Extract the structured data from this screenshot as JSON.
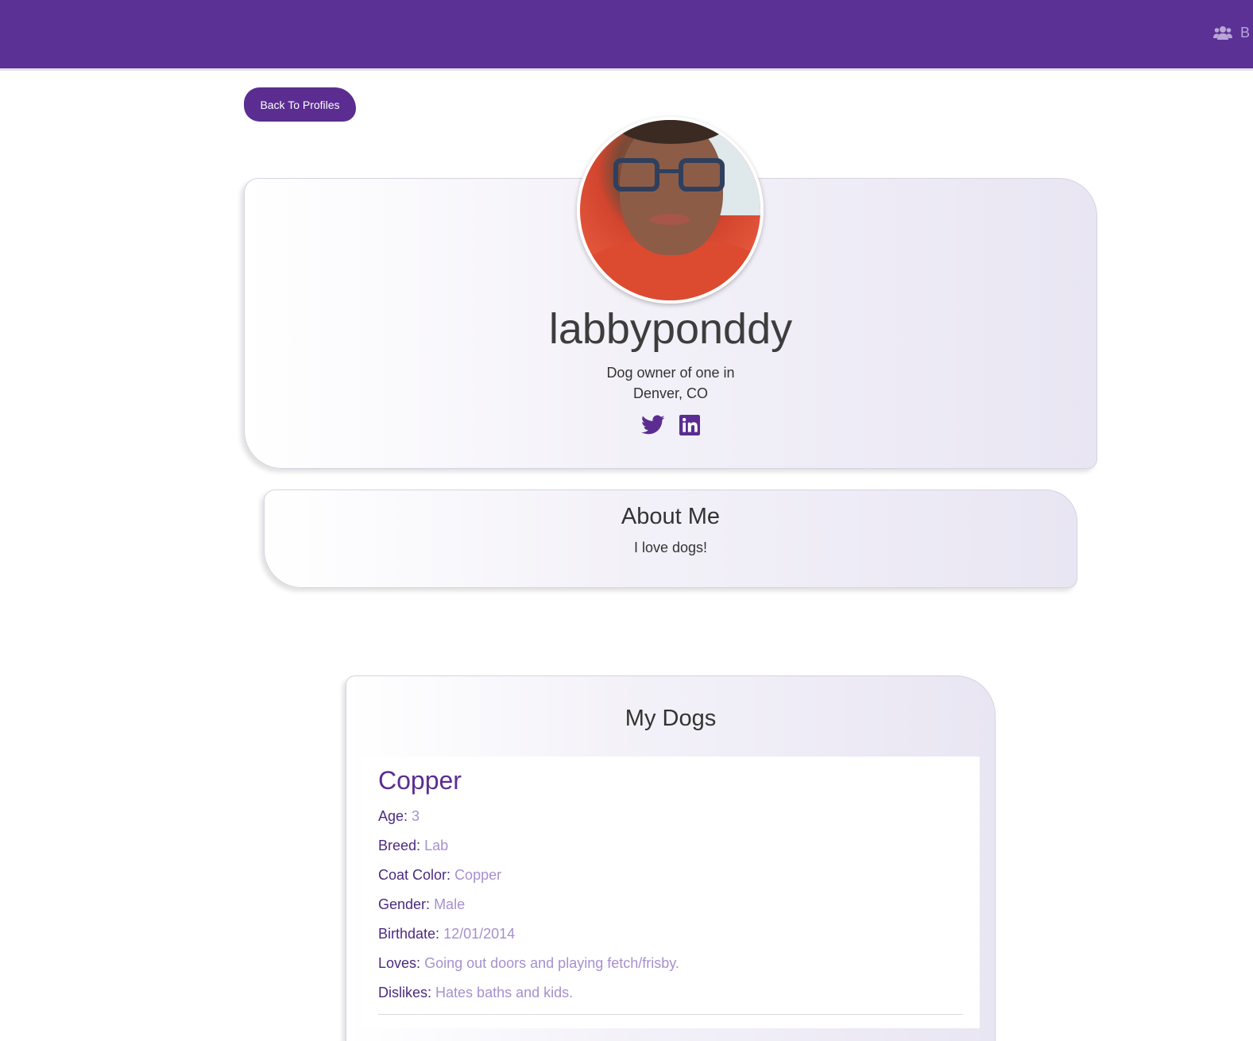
{
  "navbar": {
    "link_label": "B",
    "link_icon": "users-icon"
  },
  "back_button": {
    "label": "Back To Profiles"
  },
  "profile": {
    "username": "labbyponddy",
    "tagline_line1": "Dog owner of one in",
    "tagline_line2": "Denver, CO",
    "social_icons": [
      "twitter-icon",
      "linkedin-icon"
    ]
  },
  "about": {
    "title": "About Me",
    "text": "I love dogs!"
  },
  "dogs": {
    "title": "My Dogs",
    "items": [
      {
        "name": "Copper",
        "age_label": "Age:",
        "age": "3",
        "breed_label": "Breed:",
        "breed": "Lab",
        "coat_label": "Coat Color:",
        "coat": "Copper",
        "gender_label": "Gender:",
        "gender": "Male",
        "birthdate_label": "Birthdate:",
        "birthdate": "12/01/2014",
        "loves_label": "Loves:",
        "loves": "Going out doors and playing fetch/frisby.",
        "dislikes_label": "Dislikes:",
        "dislikes": "Hates baths and kids."
      }
    ]
  },
  "colors": {
    "brand": "#5b3196",
    "accent_light": "#a690cf",
    "button": "#5b2d91"
  }
}
